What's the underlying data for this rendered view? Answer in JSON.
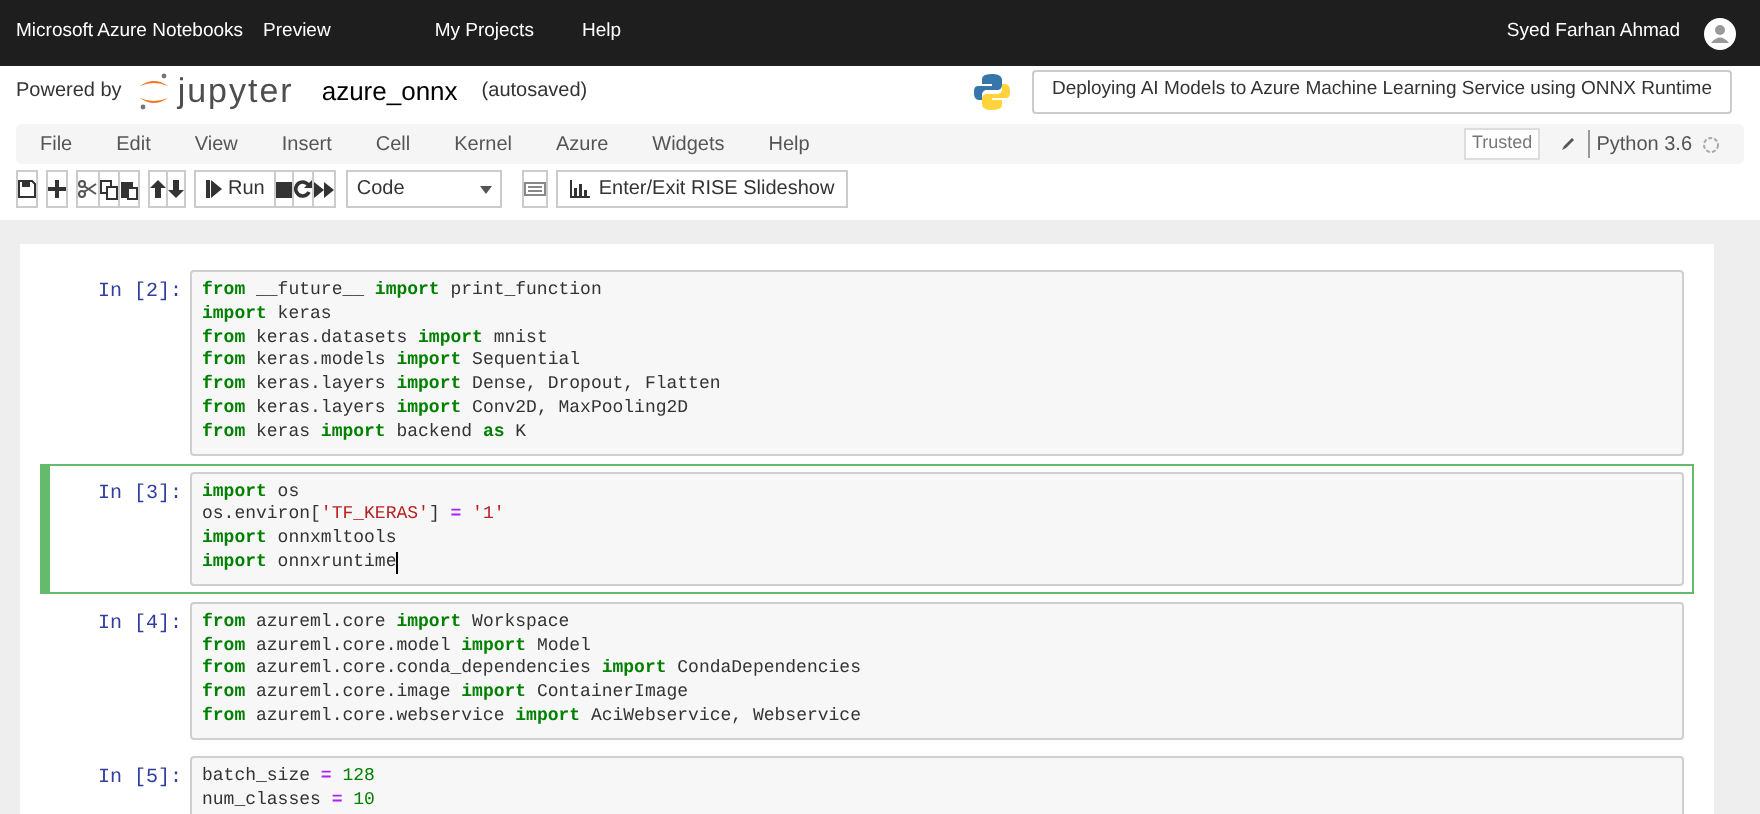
{
  "top_bar": {
    "brand": "Microsoft Azure Notebooks",
    "brand_tag": "Preview",
    "links": [
      "My Projects",
      "Help"
    ],
    "user": "Syed Farhan Ahmad"
  },
  "header": {
    "powered_by": "Powered by",
    "logo_text": "jupyter",
    "notebook_name": "azure_onnx",
    "save_status": "(autosaved)",
    "title": "Deploying AI Models to Azure Machine Learning Service using ONNX Runtime"
  },
  "menu": {
    "items": [
      "File",
      "Edit",
      "View",
      "Insert",
      "Cell",
      "Kernel",
      "Azure",
      "Widgets",
      "Help"
    ],
    "trusted": "Trusted",
    "kernel": "Python 3.6"
  },
  "toolbar": {
    "run_label": "Run",
    "cell_type": "Code",
    "rise_label": "Enter/Exit RISE Slideshow"
  },
  "cells": [
    {
      "prompt": "In [2]:",
      "selected": false,
      "lines": [
        [
          {
            "kind": "kw",
            "text": "from"
          },
          {
            "kind": "plain",
            "text": " __future__ "
          },
          {
            "kind": "kw",
            "text": "import"
          },
          {
            "kind": "plain",
            "text": " print_function"
          }
        ],
        [
          {
            "kind": "kw",
            "text": "import"
          },
          {
            "kind": "plain",
            "text": " keras"
          }
        ],
        [
          {
            "kind": "kw",
            "text": "from"
          },
          {
            "kind": "plain",
            "text": " keras.datasets "
          },
          {
            "kind": "kw",
            "text": "import"
          },
          {
            "kind": "plain",
            "text": " mnist"
          }
        ],
        [
          {
            "kind": "kw",
            "text": "from"
          },
          {
            "kind": "plain",
            "text": " keras.models "
          },
          {
            "kind": "kw",
            "text": "import"
          },
          {
            "kind": "plain",
            "text": " Sequential"
          }
        ],
        [
          {
            "kind": "kw",
            "text": "from"
          },
          {
            "kind": "plain",
            "text": " keras.layers "
          },
          {
            "kind": "kw",
            "text": "import"
          },
          {
            "kind": "plain",
            "text": " Dense, Dropout, Flatten"
          }
        ],
        [
          {
            "kind": "kw",
            "text": "from"
          },
          {
            "kind": "plain",
            "text": " keras.layers "
          },
          {
            "kind": "kw",
            "text": "import"
          },
          {
            "kind": "plain",
            "text": " Conv2D, MaxPooling2D"
          }
        ],
        [
          {
            "kind": "kw",
            "text": "from"
          },
          {
            "kind": "plain",
            "text": " keras "
          },
          {
            "kind": "kw",
            "text": "import"
          },
          {
            "kind": "plain",
            "text": " backend "
          },
          {
            "kind": "kw",
            "text": "as"
          },
          {
            "kind": "plain",
            "text": " K"
          }
        ]
      ]
    },
    {
      "prompt": "In [3]:",
      "selected": true,
      "lines": [
        [
          {
            "kind": "kw",
            "text": "import"
          },
          {
            "kind": "plain",
            "text": " os"
          }
        ],
        [
          {
            "kind": "plain",
            "text": "os.environ["
          },
          {
            "kind": "str",
            "text": "'TF_KERAS'"
          },
          {
            "kind": "plain",
            "text": "] "
          },
          {
            "kind": "op",
            "text": "="
          },
          {
            "kind": "str",
            "text": " '1'"
          }
        ],
        [
          {
            "kind": "kw",
            "text": "import"
          },
          {
            "kind": "plain",
            "text": " onnxmltools"
          }
        ],
        [
          {
            "kind": "kw",
            "text": "import"
          },
          {
            "kind": "plain",
            "text": " onnxruntime"
          }
        ]
      ]
    },
    {
      "prompt": "In [4]:",
      "selected": false,
      "lines": [
        [
          {
            "kind": "kw",
            "text": "from"
          },
          {
            "kind": "plain",
            "text": " azureml.core "
          },
          {
            "kind": "kw",
            "text": "import"
          },
          {
            "kind": "plain",
            "text": " Workspace"
          }
        ],
        [
          {
            "kind": "kw",
            "text": "from"
          },
          {
            "kind": "plain",
            "text": " azureml.core.model "
          },
          {
            "kind": "kw",
            "text": "import"
          },
          {
            "kind": "plain",
            "text": " Model"
          }
        ],
        [
          {
            "kind": "kw",
            "text": "from"
          },
          {
            "kind": "plain",
            "text": " azureml.core.conda_dependencies "
          },
          {
            "kind": "kw",
            "text": "import"
          },
          {
            "kind": "plain",
            "text": " CondaDependencies"
          }
        ],
        [
          {
            "kind": "kw",
            "text": "from"
          },
          {
            "kind": "plain",
            "text": " azureml.core.image "
          },
          {
            "kind": "kw",
            "text": "import"
          },
          {
            "kind": "plain",
            "text": " ContainerImage"
          }
        ],
        [
          {
            "kind": "kw",
            "text": "from"
          },
          {
            "kind": "plain",
            "text": " azureml.core.webservice "
          },
          {
            "kind": "kw",
            "text": "import"
          },
          {
            "kind": "plain",
            "text": " AciWebservice, Webservice"
          }
        ]
      ]
    },
    {
      "prompt": "In [5]:",
      "selected": false,
      "lines": [
        [
          {
            "kind": "plain",
            "text": "batch_size "
          },
          {
            "kind": "op",
            "text": "="
          },
          {
            "kind": "num",
            "text": " 128"
          }
        ],
        [
          {
            "kind": "plain",
            "text": "num_classes "
          },
          {
            "kind": "op",
            "text": "="
          },
          {
            "kind": "num",
            "text": " 10"
          }
        ]
      ]
    }
  ]
}
